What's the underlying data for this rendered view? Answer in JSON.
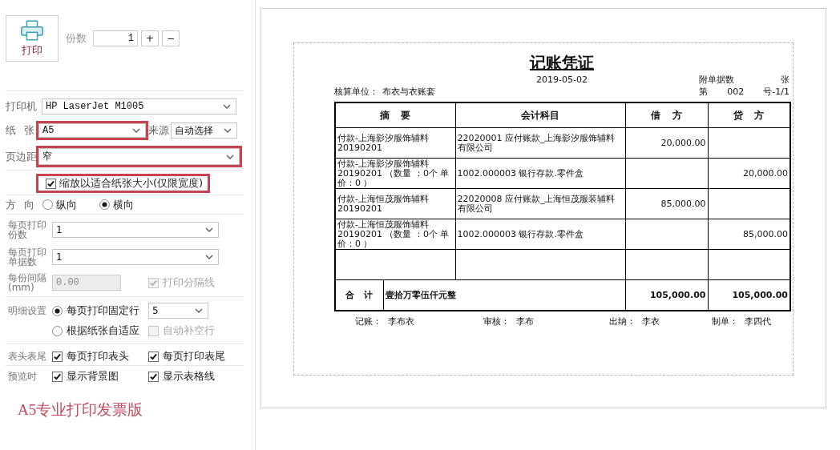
{
  "print_button": {
    "label": "打印"
  },
  "copies": {
    "label": "份数",
    "value": "1",
    "buttons": [
      "+",
      "−"
    ]
  },
  "printer": {
    "label": "打印机",
    "value": "HP LaserJet M1005"
  },
  "paper": {
    "label": "纸 张",
    "value": "A5",
    "highlighted": true,
    "source_label": "来源",
    "source_value": "自动选择"
  },
  "margin": {
    "label": "页边距",
    "value": "窄",
    "highlighted": true
  },
  "fit_to_paper": {
    "label": "缩放以适合纸张大小(仅限宽度)",
    "checked": true,
    "highlighted": true
  },
  "orientation": {
    "label": "方 向",
    "options": [
      {
        "label": "纵向",
        "selected": false
      },
      {
        "label": "横向",
        "selected": true
      }
    ]
  },
  "copies_per_page": {
    "label": "每页打印份数",
    "value": "1"
  },
  "slips_per_page": {
    "label": "每页打印单据数",
    "value": "1"
  },
  "spacing": {
    "label": "每份间隔(mm)",
    "value": "0.00",
    "disabled": true,
    "divider_line": {
      "label": "打印分隔线",
      "checked": true,
      "disabled": true
    }
  },
  "detail": {
    "label": "明细设置",
    "options": [
      {
        "label": "每页打印固定行",
        "selected": true
      },
      {
        "label": "根据纸张自适应",
        "selected": false
      }
    ],
    "fixed_rows": "5",
    "auto_fill": {
      "label": "自动补空行",
      "checked": false,
      "disabled": true
    }
  },
  "header_footer": {
    "label": "表头表尾",
    "checks": [
      {
        "label": "每页打印表头",
        "checked": true
      },
      {
        "label": "每页打印表尾",
        "checked": true
      }
    ]
  },
  "preview": {
    "label": "预览时",
    "checks": [
      {
        "label": "显示背景图",
        "checked": true
      },
      {
        "label": "显示表格线",
        "checked": true
      }
    ]
  },
  "note": "A5专业打印发票版",
  "voucher": {
    "title": "记账凭证",
    "date": "2019-05-02",
    "attachments_label": "附单据数",
    "attachments_unit": "张",
    "unit_label": "核算单位：",
    "unit": "布衣与衣账套",
    "number_prefix": "第",
    "number": "002",
    "number_suffix": "号-1/1",
    "columns": [
      "摘 要",
      "会计科目",
      "借 方",
      "贷 方"
    ],
    "rows": [
      {
        "summary": "付款-上海影汐服饰辅料20190201",
        "account": "22020001 应付账款_上海影汐服饰辅料有限公司",
        "debit": "20,000.00"
      },
      {
        "summary": "付款-上海影汐服饰辅料20190201 （数量 ：0个 单价：0 ）",
        "account": "1002.000003 银行存款.零件盒",
        "credit": "20,000.00"
      },
      {
        "summary": "付款-上海恒茂服饰辅料20190201",
        "account": "22020008 应付账款_上海恒茂服装辅料有限公司",
        "debit": "85,000.00"
      },
      {
        "summary": "付款-上海恒茂服饰辅料20190201 （数量 ：0个 单价：0 ）",
        "account": "1002.000003 银行存款.零件盒",
        "credit": "85,000.00"
      }
    ],
    "total": {
      "label": "合 计",
      "amount_words": "壹拾万零伍仟元整",
      "debit": "105,000.00",
      "credit": "105,000.00"
    },
    "signatures": [
      {
        "label": "记账：",
        "name": "李布衣"
      },
      {
        "label": "审核：",
        "name": "李布"
      },
      {
        "label": "出纳：",
        "name": "李衣"
      },
      {
        "label": "制单：",
        "name": "李四代"
      }
    ]
  }
}
